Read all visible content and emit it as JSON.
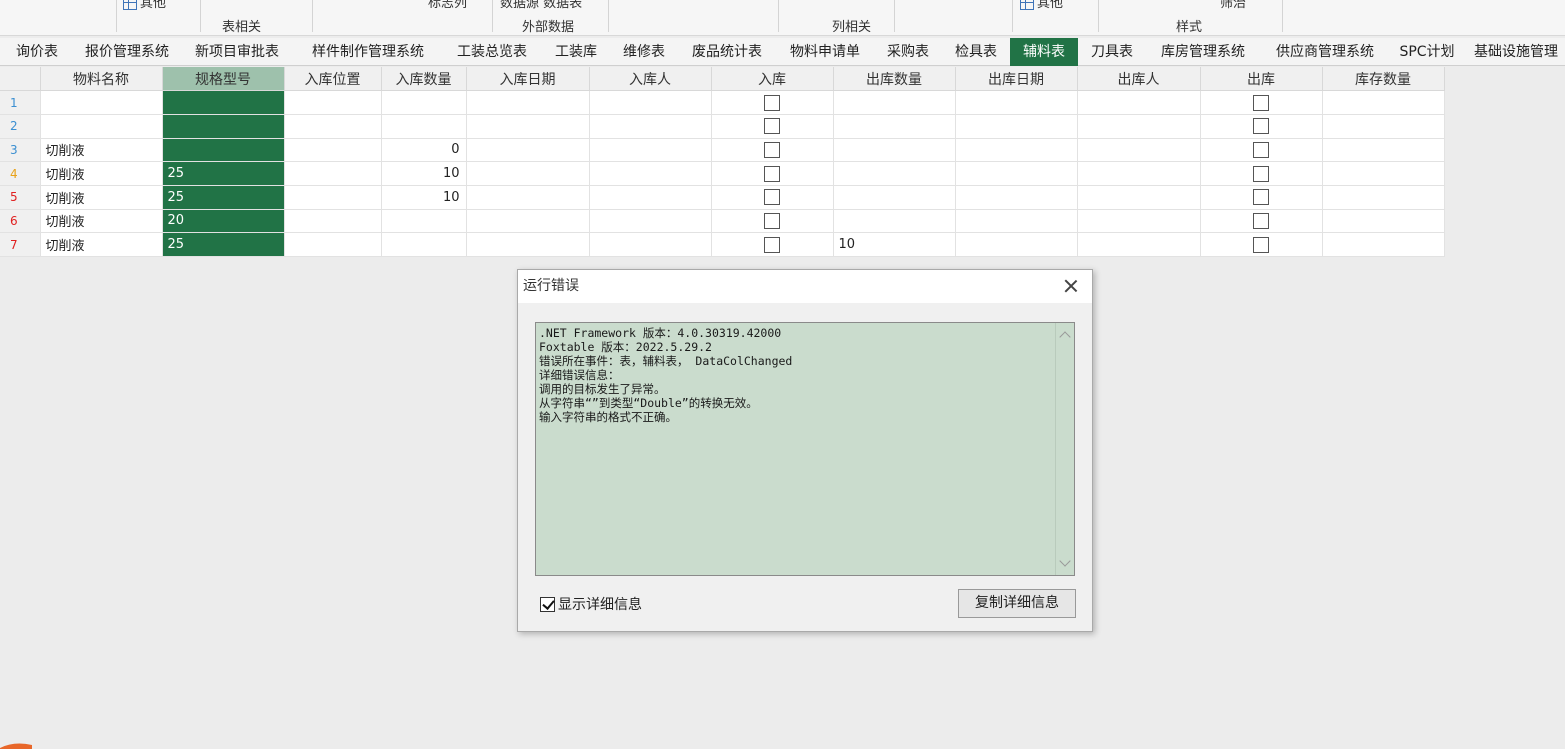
{
  "ribbon": {
    "groups": [
      "表相关",
      "外部数据",
      "列相关",
      "样式"
    ],
    "partials": [
      "其他",
      "标志列",
      "数据源 数据表",
      "其他",
      "筛治"
    ]
  },
  "tabs": [
    {
      "label": "询价表"
    },
    {
      "label": "报价管理系统"
    },
    {
      "label": "新项目审批表"
    },
    {
      "label": "样件制作管理系统"
    },
    {
      "label": "工装总览表"
    },
    {
      "label": "工装库"
    },
    {
      "label": "维修表"
    },
    {
      "label": "废品统计表"
    },
    {
      "label": "物料申请单"
    },
    {
      "label": "采购表"
    },
    {
      "label": "检具表"
    },
    {
      "label": "辅料表",
      "active": true
    },
    {
      "label": "刀具表"
    },
    {
      "label": "库房管理系统"
    },
    {
      "label": "供应商管理系统"
    },
    {
      "label": "SPC计划"
    },
    {
      "label": "基础设施管理"
    }
  ],
  "table": {
    "columns": [
      "",
      "物料名称",
      "规格型号",
      "入库位置",
      "入库数量",
      "入库日期",
      "入库人",
      "入库",
      "出库数量",
      "出库日期",
      "出库人",
      "出库",
      "库存数量"
    ],
    "rows": [
      {
        "num": "1",
        "num_color": "#3b8fd1",
        "name": "",
        "spec": "",
        "in_loc": "",
        "in_qty": "",
        "in_date": "",
        "in_person": "",
        "in_check": false,
        "out_qty": "",
        "out_date": "",
        "out_person": "",
        "out_check": false,
        "stock": ""
      },
      {
        "num": "2",
        "num_color": "#3b8fd1",
        "name": "",
        "spec": "",
        "in_loc": "",
        "in_qty": "",
        "in_date": "",
        "in_person": "",
        "in_check": false,
        "out_qty": "",
        "out_date": "",
        "out_person": "",
        "out_check": false,
        "stock": ""
      },
      {
        "num": "3",
        "num_color": "#3b8fd1",
        "name": "切削液",
        "spec": "",
        "in_loc": "",
        "in_qty": "0",
        "in_date": "",
        "in_person": "",
        "in_check": false,
        "out_qty": "",
        "out_date": "",
        "out_person": "",
        "out_check": false,
        "stock": ""
      },
      {
        "num": "4",
        "num_color": "#e8a21a",
        "name": "切削液",
        "spec": "25",
        "in_loc": "",
        "in_qty": "10",
        "in_date": "",
        "in_person": "",
        "in_check": false,
        "out_qty": "",
        "out_date": "",
        "out_person": "",
        "out_check": false,
        "stock": ""
      },
      {
        "num": "5",
        "num_color": "#e02020",
        "name": "切削液",
        "spec": "25",
        "in_loc": "",
        "in_qty": "10",
        "in_date": "",
        "in_person": "",
        "in_check": false,
        "out_qty": "",
        "out_date": "",
        "out_person": "",
        "out_check": false,
        "stock": ""
      },
      {
        "num": "6",
        "num_color": "#e02020",
        "name": "切削液",
        "spec": "20",
        "in_loc": "",
        "in_qty": "",
        "in_date": "",
        "in_person": "",
        "in_check": false,
        "out_qty": "",
        "out_date": "",
        "out_person": "",
        "out_check": false,
        "stock": ""
      },
      {
        "num": "7",
        "num_color": "#e02020",
        "name": "切削液",
        "spec": "25",
        "in_loc": "",
        "in_qty": "",
        "in_date": "",
        "in_person": "",
        "in_check": false,
        "out_qty": "10",
        "out_date": "",
        "out_person": "",
        "out_check": false,
        "stock": ""
      }
    ]
  },
  "dialog": {
    "title": "运行错误",
    "details": ".NET Framework 版本：4.0.30319.42000\nFoxtable 版本：2022.5.29.2\n错误所在事件：表，辅料表， DataColChanged\n详细错误信息：\n调用的目标发生了异常。\n从字符串“”到类型“Double”的转换无效。\n输入字符串的格式不正确。",
    "show_details_label": "显示详细信息",
    "show_details_checked": true,
    "copy_button": "复制详细信息"
  },
  "colors": {
    "accent_green": "#217346",
    "selected_header": "#9ec1ac",
    "detail_background": "#cadccd",
    "corner_mark": "#e8672a"
  }
}
